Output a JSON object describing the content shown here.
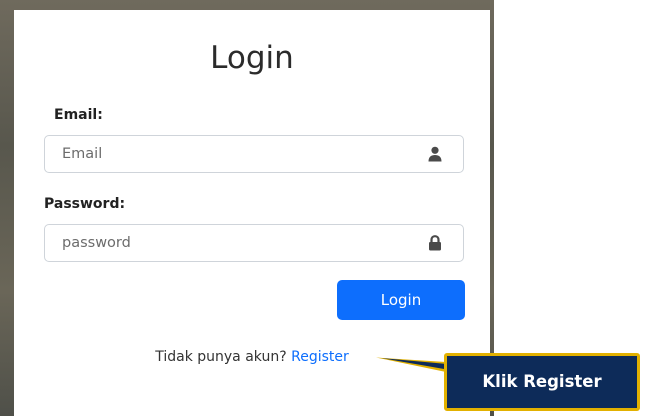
{
  "login": {
    "title": "Login",
    "email_label": "Email:",
    "email_placeholder": "Email",
    "password_label": "Password:",
    "password_placeholder": "password",
    "submit_label": "Login",
    "footer_text": "Tidak punya akun?",
    "register_link": "Register"
  },
  "annotation": {
    "callout_text": "Klik Register"
  },
  "colors": {
    "primary": "#0d6efd",
    "callout_bg": "#0d2b59",
    "callout_border": "#e2b100"
  },
  "icons": {
    "email": "user-icon",
    "password": "lock-icon"
  }
}
